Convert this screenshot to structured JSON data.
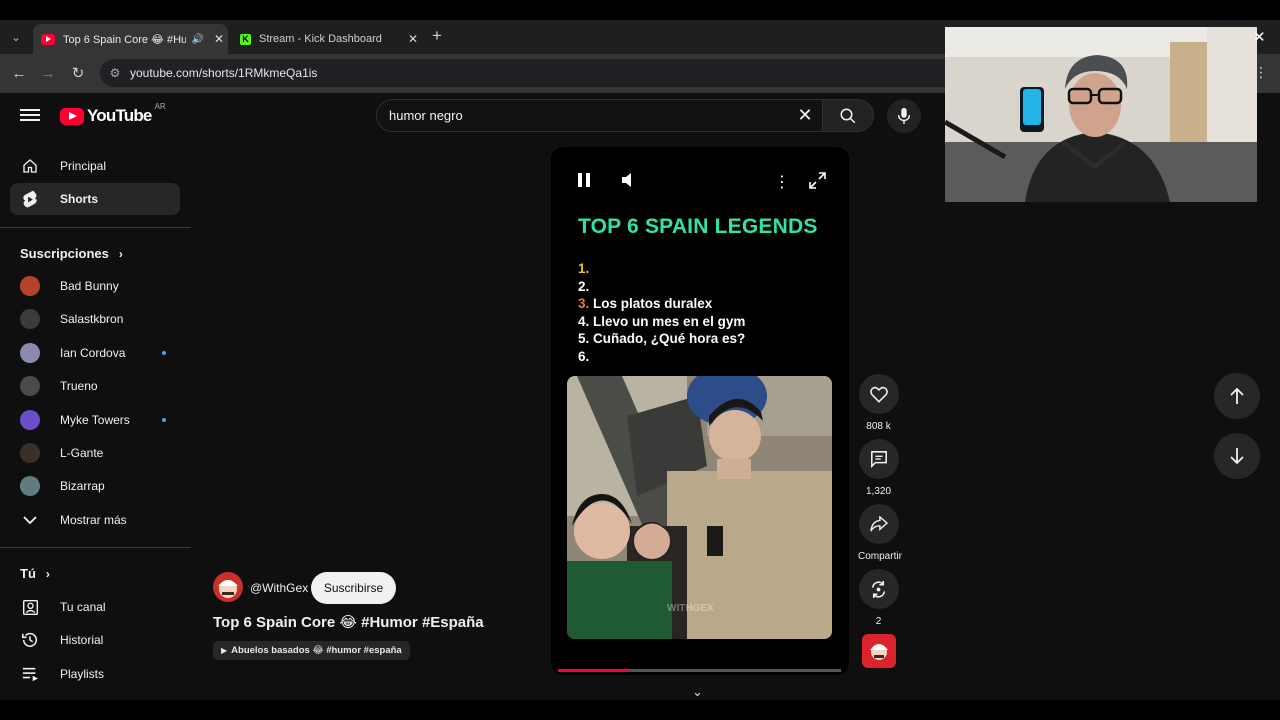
{
  "browser": {
    "tabs": [
      {
        "title": "Top 6 Spain Core 😂 #Humor #España",
        "active": true
      },
      {
        "title": "Stream - Kick Dashboard",
        "active": false
      }
    ],
    "url": "youtube.com/shorts/1RMkmeQa1is"
  },
  "header": {
    "logo_text": "YouTube",
    "country_code": "AR",
    "search_query": "humor negro"
  },
  "sidebar": {
    "main_items": [
      {
        "label": "Principal",
        "icon": "home-icon"
      },
      {
        "label": "Shorts",
        "icon": "shorts-icon"
      }
    ],
    "subscriptions_heading": "Suscripciones",
    "subscriptions": [
      {
        "label": "Bad Bunny",
        "color": "#b8412e",
        "new": false
      },
      {
        "label": "Salastkbron",
        "color": "#3b3b3b",
        "new": false
      },
      {
        "label": "Ian Cordova",
        "color": "#8a8ab0",
        "new": true
      },
      {
        "label": "Trueno",
        "color": "#4a4a4a",
        "new": false
      },
      {
        "label": "Myke Towers",
        "color": "#6a4fc9",
        "new": true
      },
      {
        "label": "L-Gante",
        "color": "#3a3026",
        "new": false
      },
      {
        "label": "Bizarrap",
        "color": "#5f7c83",
        "new": false
      }
    ],
    "show_more": "Mostrar más",
    "you_heading": "Tú",
    "you_items": [
      {
        "label": "Tu canal",
        "icon": "account-box-icon"
      },
      {
        "label": "Historial",
        "icon": "history-icon"
      },
      {
        "label": "Playlists",
        "icon": "playlist-icon"
      }
    ]
  },
  "short": {
    "title": "TOP 6 SPAIN LEGENDS",
    "ranking": [
      {
        "num": "1.",
        "text": ""
      },
      {
        "num": "2.",
        "text": ""
      },
      {
        "num": "3.",
        "text": "Los platos duralex"
      },
      {
        "num": "4.",
        "text": "Llevo un mes en el gym"
      },
      {
        "num": "5.",
        "text": "Cuñado, ¿Qué hora es?"
      },
      {
        "num": "6.",
        "text": ""
      }
    ],
    "watermark": "WITHGEX",
    "progress": 0.25
  },
  "actions": {
    "likes": "808 k",
    "comments": "1,320",
    "share": "Compartir",
    "remix": "2"
  },
  "channel": {
    "handle": "@WithGex",
    "subscribe_label": "Suscribirse",
    "video_title": "Top 6 Spain Core 😂 #Humor #España",
    "music_chip": "Abuelos basados 😂 #humor #españa"
  }
}
